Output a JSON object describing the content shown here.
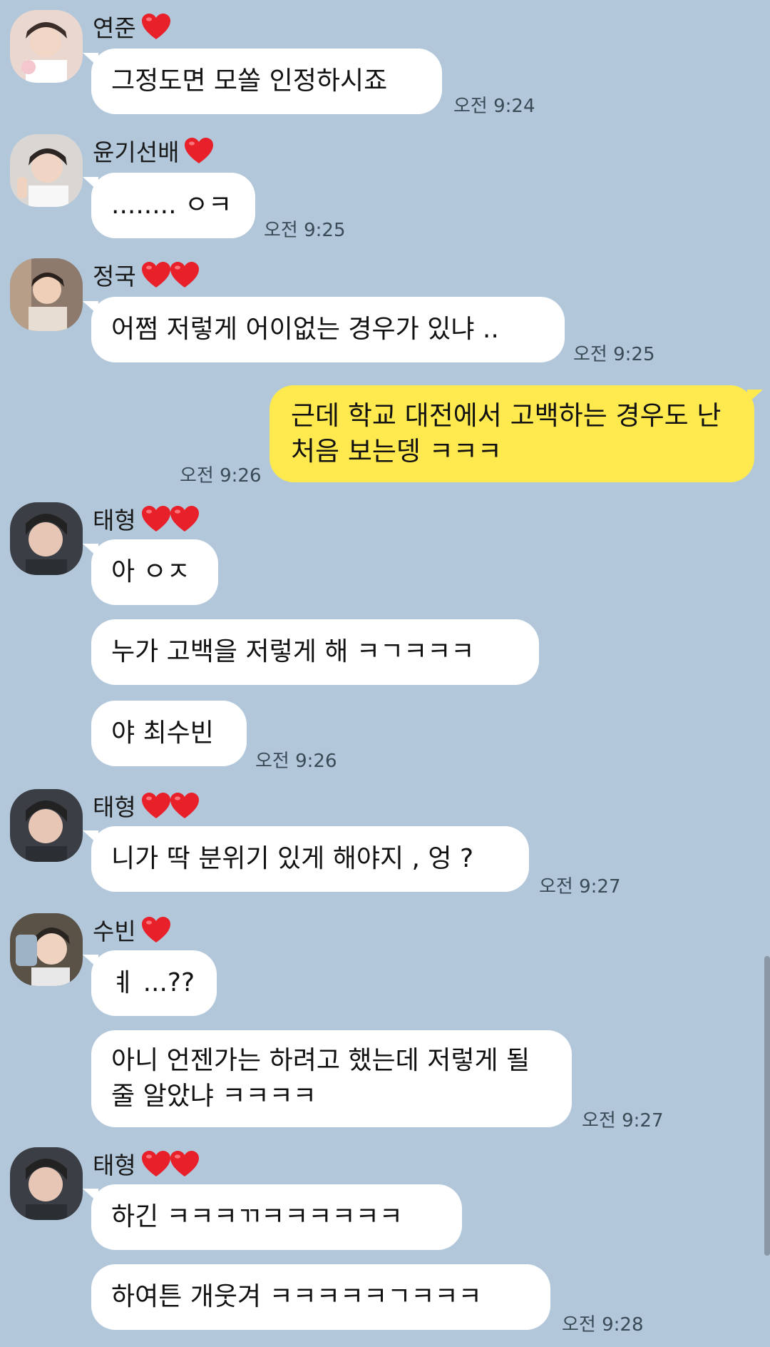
{
  "chat": {
    "messages": [
      {
        "sender": "연준",
        "hearts": 1,
        "bubbles": [
          "그정도면 모쏠 인정하시죠"
        ],
        "time": "오전 9:24"
      },
      {
        "sender": "윤기선배",
        "hearts": 1,
        "bubbles": [
          "........ ㅇㅋ"
        ],
        "time": "오전 9:25"
      },
      {
        "sender": "정국",
        "hearts": 2,
        "bubbles": [
          "어쩜 저렇게 어이없는 경우가 있냐 .."
        ],
        "time": "오전 9:25"
      },
      {
        "sender": "me",
        "bubbles": [
          "근데 학교 대전에서 고백하는 경우도 난 처음 보는뎅 ㅋㅋㅋ"
        ],
        "time": "오전 9:26"
      },
      {
        "sender": "태형",
        "hearts": 2,
        "bubbles": [
          "아 ㅇㅈ",
          "누가 고백을 저렇게 해 ㅋㄱㅋㅋㅋ",
          "야 최수빈"
        ],
        "time": "오전 9:26"
      },
      {
        "sender": "태형",
        "hearts": 2,
        "bubbles": [
          "니가 딱 분위기 있게 해야지 , 엉 ?"
        ],
        "time": "오전 9:27"
      },
      {
        "sender": "수빈",
        "hearts": 1,
        "bubbles": [
          "ㅖ ...??",
          "아니 언젠가는 하려고 했는데 저렇게 될줄 알았냐 ㅋㅋㅋㅋ"
        ],
        "time": "오전 9:27"
      },
      {
        "sender": "태형",
        "hearts": 2,
        "bubbles": [
          "하긴 ㅋㅋㅋㄲㅋㅋㅋㅋㅋㅋ",
          "하여튼 개웃겨 ㅋㅋㅋㅋㅋㄱㅋㅋㅋ"
        ],
        "time": "오전 9:28"
      }
    ]
  },
  "colors": {
    "background": "#b2c7da",
    "my_bubble": "#fee94e",
    "other_bubble": "#ffffff",
    "heart": "#e8202a"
  }
}
